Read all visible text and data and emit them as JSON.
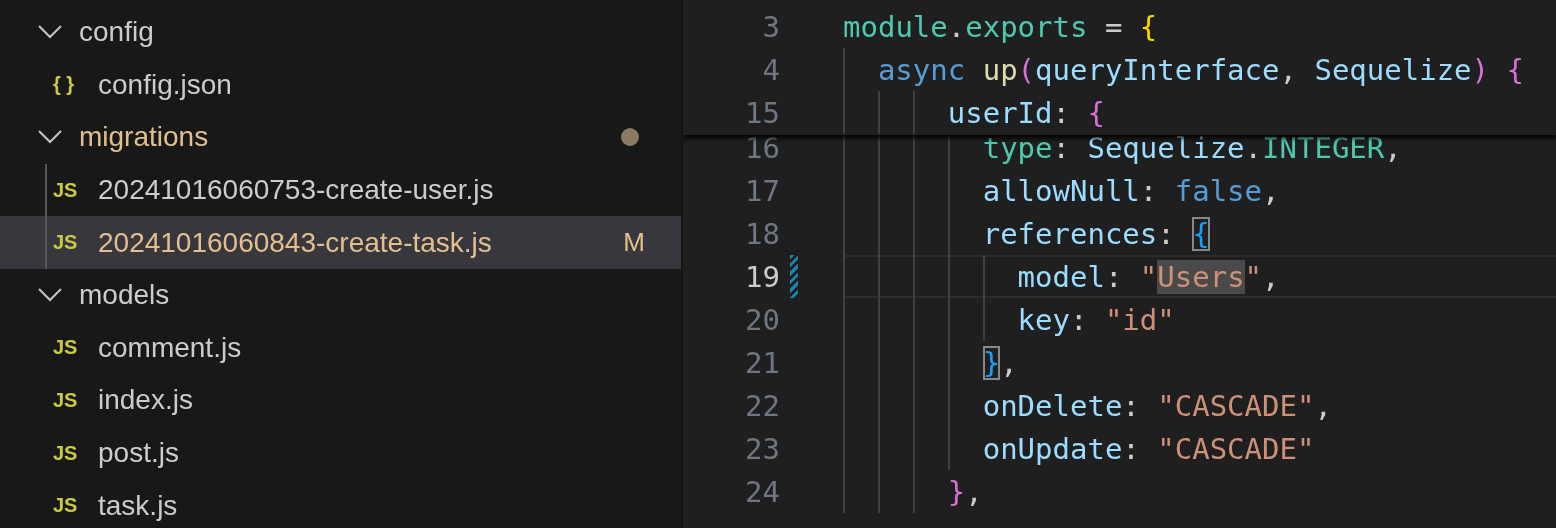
{
  "explorer": {
    "items": [
      {
        "kind": "folder",
        "label": "config",
        "expanded": true,
        "selected": false,
        "modified": false,
        "children": [
          {
            "kind": "file",
            "icon": "{ }",
            "label": "config.json",
            "selected": false,
            "modified": false
          }
        ]
      },
      {
        "kind": "folder",
        "label": "migrations",
        "expanded": true,
        "selected": false,
        "modified": true,
        "children": [
          {
            "kind": "file",
            "icon": "JS",
            "label": "20241016060753-create-user.js",
            "selected": false,
            "modified": false
          },
          {
            "kind": "file",
            "icon": "JS",
            "label": "20241016060843-create-task.js",
            "selected": true,
            "modified": true,
            "badge": "M"
          }
        ]
      },
      {
        "kind": "folder",
        "label": "models",
        "expanded": true,
        "selected": false,
        "modified": false,
        "children": [
          {
            "kind": "file",
            "icon": "JS",
            "label": "comment.js",
            "selected": false,
            "modified": false
          },
          {
            "kind": "file",
            "icon": "JS",
            "label": "index.js",
            "selected": false,
            "modified": false
          },
          {
            "kind": "file",
            "icon": "JS",
            "label": "post.js",
            "selected": false,
            "modified": false
          },
          {
            "kind": "file",
            "icon": "JS",
            "label": "task.js",
            "selected": false,
            "modified": false
          }
        ]
      }
    ]
  },
  "editor": {
    "sticky_lines": [
      {
        "number": "3",
        "tokens": [
          {
            "text": "module",
            "kind": "type"
          },
          {
            "text": ".",
            "kind": "punct"
          },
          {
            "text": "exports",
            "kind": "type"
          },
          {
            "text": " = ",
            "kind": "punct"
          },
          {
            "text": "{",
            "kind": "bracket1"
          }
        ]
      },
      {
        "number": "4",
        "tokens": [
          {
            "text": "  async ",
            "kind": "keyword"
          },
          {
            "text": "up",
            "kind": "func"
          },
          {
            "text": "(",
            "kind": "bracket2"
          },
          {
            "text": "queryInterface",
            "kind": "prop"
          },
          {
            "text": ", ",
            "kind": "punct"
          },
          {
            "text": "Sequelize",
            "kind": "prop"
          },
          {
            "text": ")",
            "kind": "bracket2"
          },
          {
            "text": " {",
            "kind": "bracket2"
          }
        ]
      },
      {
        "number": "15",
        "tokens": [
          {
            "text": "      userId",
            "kind": "prop"
          },
          {
            "text": ": ",
            "kind": "punct"
          },
          {
            "text": "{",
            "kind": "bracket2"
          }
        ]
      }
    ],
    "lines": [
      {
        "number": "16",
        "current": false,
        "changed": false,
        "tokens": [
          {
            "text": "        type",
            "kind": "type"
          },
          {
            "text": ": ",
            "kind": "punct"
          },
          {
            "text": "Sequelize",
            "kind": "prop"
          },
          {
            "text": ".",
            "kind": "punct"
          },
          {
            "text": "INTEGER",
            "kind": "type"
          },
          {
            "text": ",",
            "kind": "punct"
          }
        ]
      },
      {
        "number": "17",
        "current": false,
        "changed": false,
        "tokens": [
          {
            "text": "        allowNull",
            "kind": "prop"
          },
          {
            "text": ": ",
            "kind": "punct"
          },
          {
            "text": "false",
            "kind": "keyword"
          },
          {
            "text": ",",
            "kind": "punct"
          }
        ]
      },
      {
        "number": "18",
        "current": false,
        "changed": false,
        "tokens": [
          {
            "text": "        references",
            "kind": "prop"
          },
          {
            "text": ": ",
            "kind": "punct"
          },
          {
            "text": "{",
            "kind": "bracket3",
            "matched": true
          }
        ]
      },
      {
        "number": "19",
        "current": true,
        "changed": true,
        "tokens": [
          {
            "text": "          model",
            "kind": "prop"
          },
          {
            "text": ": ",
            "kind": "punct"
          },
          {
            "text": "\"",
            "kind": "string"
          },
          {
            "text": "Users",
            "kind": "string",
            "highlighted": true
          },
          {
            "text": "\"",
            "kind": "string"
          },
          {
            "text": ",",
            "kind": "punct"
          }
        ]
      },
      {
        "number": "20",
        "current": false,
        "changed": false,
        "tokens": [
          {
            "text": "          key",
            "kind": "prop"
          },
          {
            "text": ": ",
            "kind": "punct"
          },
          {
            "text": "\"id\"",
            "kind": "string"
          }
        ]
      },
      {
        "number": "21",
        "current": false,
        "changed": false,
        "tokens": [
          {
            "text": "        }",
            "kind": "bracket3",
            "matched": true
          },
          {
            "text": ",",
            "kind": "punct"
          }
        ]
      },
      {
        "number": "22",
        "current": false,
        "changed": false,
        "tokens": [
          {
            "text": "        onDelete",
            "kind": "prop"
          },
          {
            "text": ": ",
            "kind": "punct"
          },
          {
            "text": "\"CASCADE\"",
            "kind": "string"
          },
          {
            "text": ",",
            "kind": "punct"
          }
        ]
      },
      {
        "number": "23",
        "current": false,
        "changed": false,
        "tokens": [
          {
            "text": "        onUpdate",
            "kind": "prop"
          },
          {
            "text": ": ",
            "kind": "punct"
          },
          {
            "text": "\"CASCADE\"",
            "kind": "string"
          }
        ]
      },
      {
        "number": "24",
        "current": false,
        "changed": false,
        "tokens": [
          {
            "text": "      }",
            "kind": "bracket2"
          },
          {
            "text": ",",
            "kind": "punct"
          }
        ]
      }
    ]
  }
}
